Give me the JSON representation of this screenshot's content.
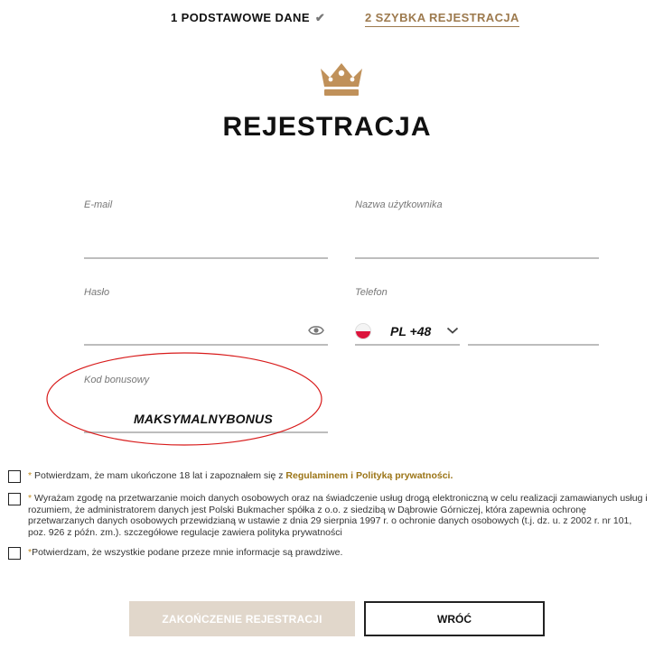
{
  "steps": {
    "step1_label": "1 PODSTAWOWE DANE",
    "step2_label": "2 SZYBKA REJESTRACJA"
  },
  "title": "REJESTRACJA",
  "form": {
    "email_label": "E-mail",
    "email_value": "",
    "username_label": "Nazwa użytkownika",
    "username_value": "",
    "password_label": "Hasło",
    "password_value": "",
    "phone_label": "Telefon",
    "phone_prefix": "PL +48",
    "phone_value": "",
    "bonus_label": "Kod bonusowy",
    "bonus_value": "MAKSYMALNYBONUS"
  },
  "consents": {
    "c1_before": " Potwierdzam, że mam ukończone 18 lat i zapoznałem się z ",
    "c1_link1": "Regulaminem",
    "c1_and": "i",
    "c1_link2": "Polityką prywatności.",
    "c2_text": " Wyrażam zgodę na przetwarzanie moich danych osobowych oraz na świadczenie usług drogą elektroniczną w celu realizacji zamawianych usług i rozumiem, że administratorem danych jest Polski Bukmacher spółka z o.o. z siedzibą w Dąbrowie Górniczej, która zapewnia ochronę przetwarzanych danych osobowych przewidzianą w ustawie z dnia 29 sierpnia 1997 r. o ochronie danych osobowych (t.j. dz. u. z 2002 r. nr 101, poz. 926 z późn. zm.). szczegółowe regulacje zawiera polityka prywatności",
    "c3_text": "Potwierdzam, że wszystkie podane przeze mnie informacje są prawdziwe.",
    "required_mark": "*"
  },
  "buttons": {
    "finish_label": "ZAKOŃCZENIE REJESTRACJI",
    "back_label": "WRÓĆ"
  },
  "colors": {
    "accent_gold": "#9d7a4e",
    "crown": "#c0915a",
    "annotation_ellipse": "#d81b1b",
    "flag_red": "#dc143c"
  },
  "icons": [
    "check-icon",
    "crown-logo-icon",
    "eye-icon",
    "poland-flag-icon",
    "chevron-down-icon"
  ]
}
